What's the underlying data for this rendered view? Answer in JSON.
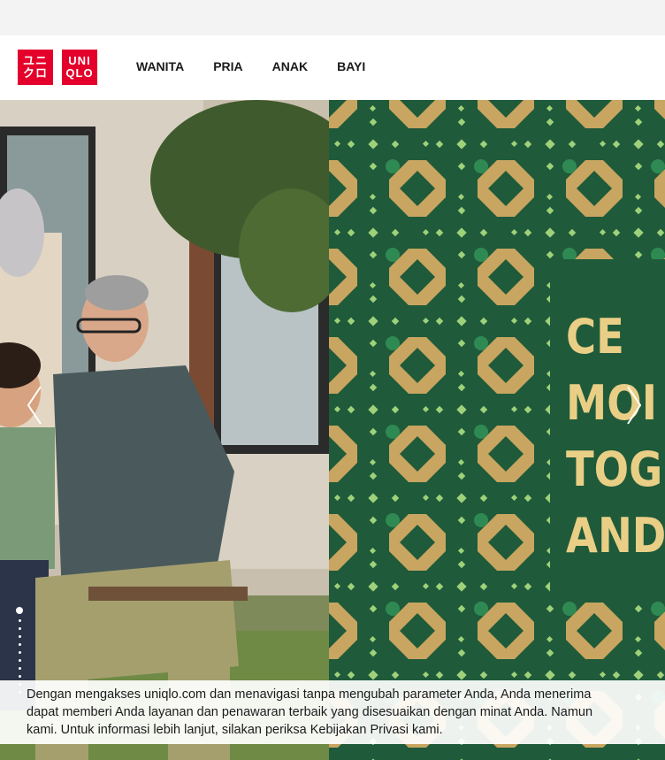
{
  "brand": {
    "logo_katakana": [
      "ユニ",
      "クロ"
    ],
    "logo_latin": [
      "UNI",
      "QLO"
    ],
    "color": "#e4002b"
  },
  "nav": {
    "items": [
      "WANITA",
      "PRIA",
      "ANAK",
      "BAYI"
    ]
  },
  "hero": {
    "headline_lines": [
      "CE",
      "MOI",
      "TOGE",
      "AND"
    ],
    "text_color": "#e9cf86",
    "pattern_bg": "#1f5a3a",
    "slide_dots": 11,
    "active_dot": 1
  },
  "cookie_notice": {
    "line1": "Dengan mengakses uniqlo.com dan menavigasi tanpa mengubah parameter Anda, Anda menerima",
    "line2": "dapat memberi Anda layanan dan penawaran terbaik yang disesuaikan dengan minat Anda. Namun",
    "line3": "kami. Untuk informasi lebih lanjut, silakan periksa Kebijakan Privasi kami."
  }
}
